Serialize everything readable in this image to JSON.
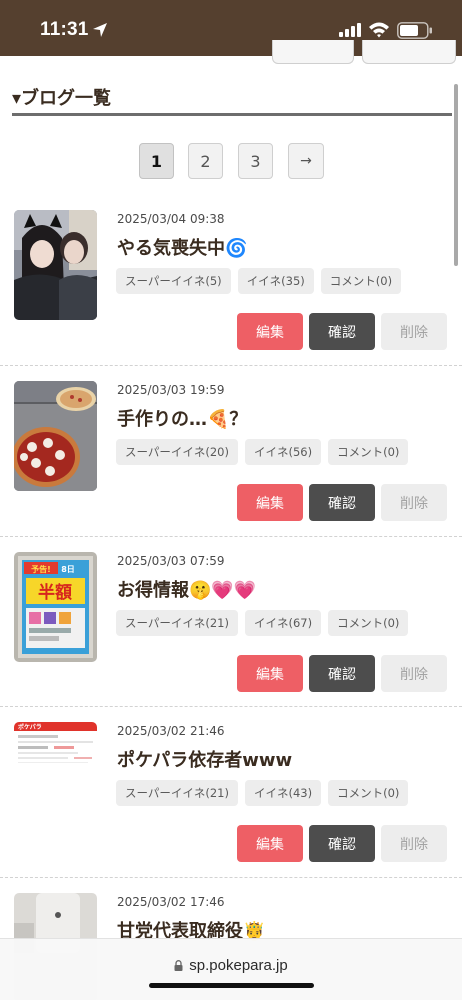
{
  "status_bar": {
    "time": "11:31"
  },
  "section": {
    "title": "▾ブログ一覧"
  },
  "pagination": {
    "pages": [
      "1",
      "2",
      "3"
    ],
    "current": "1",
    "next": "→"
  },
  "posts": [
    {
      "date": "2025/03/04 09:38",
      "title": "やる気喪失中🌀",
      "super_like": "スーパーイイネ(5)",
      "like": "イイネ(35)",
      "comment": "コメント(0)",
      "actions": {
        "edit": "編集",
        "view": "確認",
        "delete": "削除"
      }
    },
    {
      "date": "2025/03/03 19:59",
      "title": "手作りの…🍕？",
      "super_like": "スーパーイイネ(20)",
      "like": "イイネ(56)",
      "comment": "コメント(0)",
      "actions": {
        "edit": "編集",
        "view": "確認",
        "delete": "削除"
      }
    },
    {
      "date": "2025/03/03 07:59",
      "title": "お得情報🤫💗💗",
      "super_like": "スーパーイイネ(21)",
      "like": "イイネ(67)",
      "comment": "コメント(0)",
      "actions": {
        "edit": "編集",
        "view": "確認",
        "delete": "削除"
      }
    },
    {
      "date": "2025/03/02 21:46",
      "title": "ポケパラ依存者www",
      "super_like": "スーパーイイネ(21)",
      "like": "イイネ(43)",
      "comment": "コメント(0)",
      "actions": {
        "edit": "編集",
        "view": "確認",
        "delete": "削除"
      }
    },
    {
      "date": "2025/03/02 17:46",
      "title": "甘党代表取締役🤴"
    }
  ],
  "thumb_text": {
    "poster_top": "予告!",
    "poster_main": "半額",
    "poster_date": "8日",
    "site_logo": "ポケパラ"
  },
  "browser": {
    "url": "sp.pokepara.jp"
  },
  "colors": {
    "status_bar": "#55402f",
    "edit": "#ee5f65",
    "view": "#4d4d4d",
    "delete": "#ededed"
  }
}
